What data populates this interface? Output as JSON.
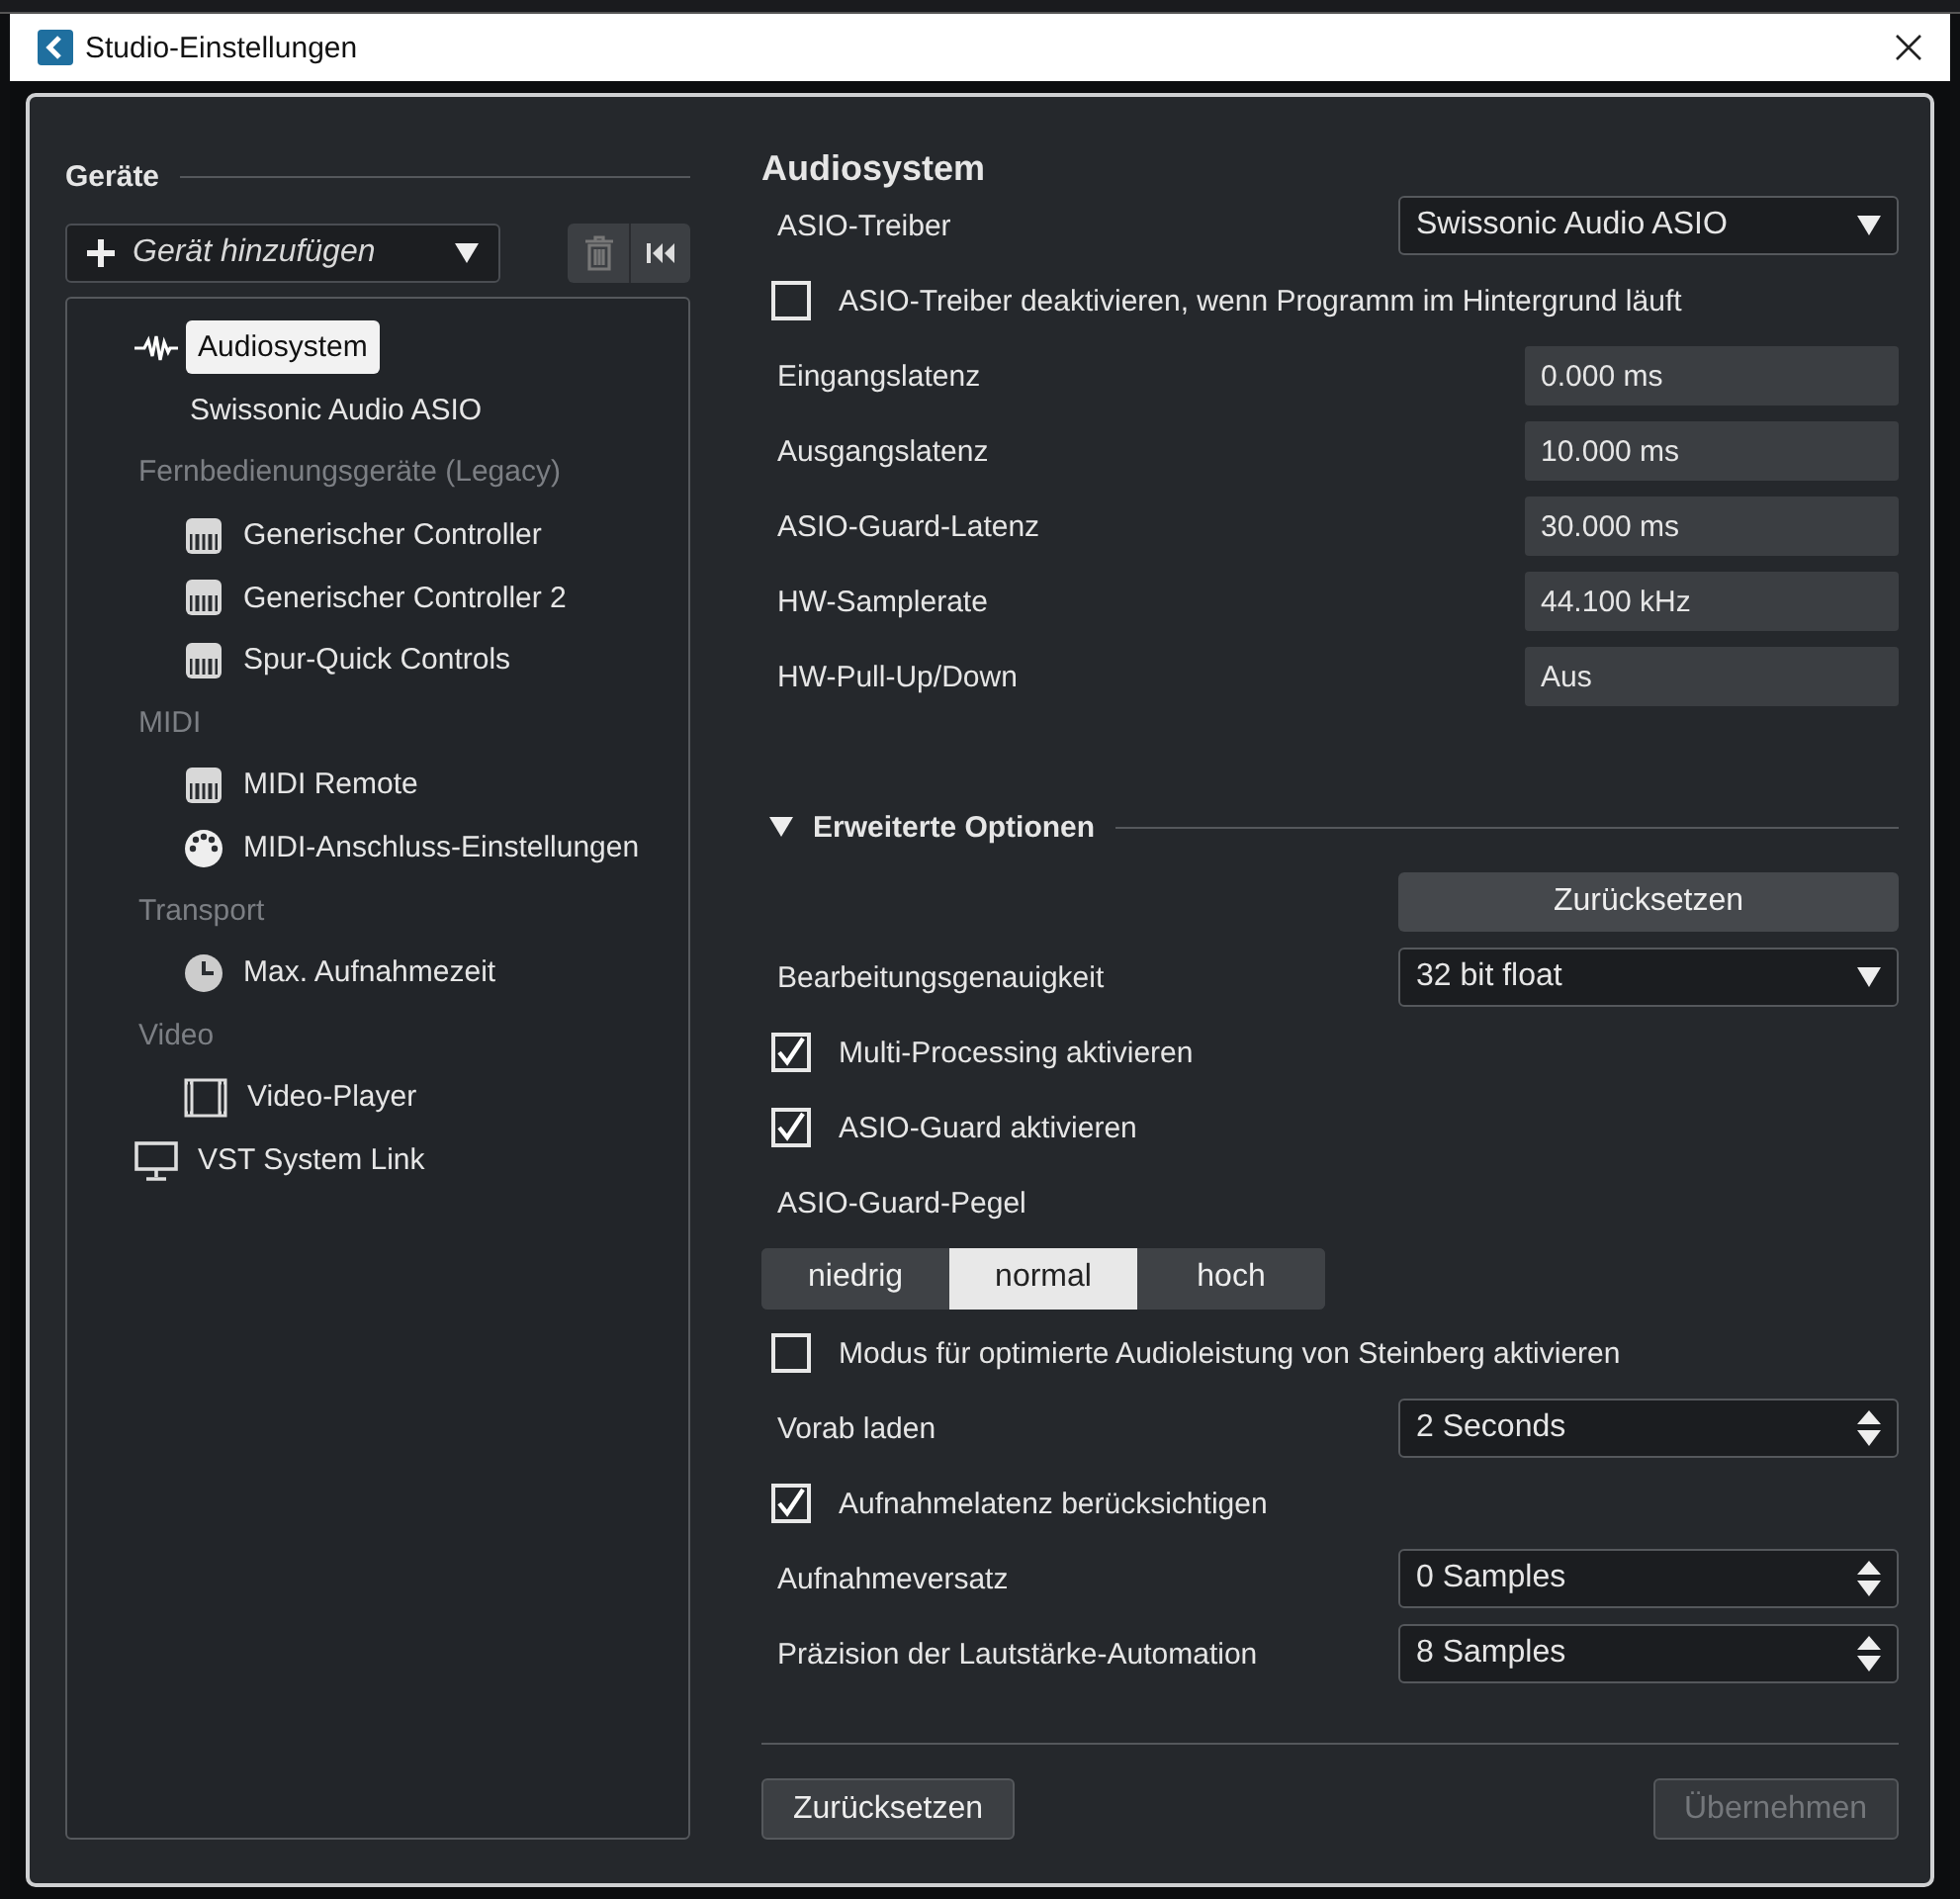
{
  "window": {
    "title": "Studio-Einstellungen"
  },
  "devices": {
    "header": "Geräte",
    "add_device": "Gerät hinzufügen",
    "tree": [
      {
        "kind": "audio",
        "label": "Audiosystem",
        "selected": true,
        "children": [
          {
            "kind": "port",
            "label": "Swissonic Audio ASIO",
            "selected": false
          }
        ]
      },
      {
        "kind": "category",
        "label": "Fernbedienungsgeräte (Legacy)",
        "children": [
          {
            "kind": "controller",
            "label": "Generischer Controller",
            "selected": false
          },
          {
            "kind": "controller",
            "label": "Generischer Controller 2",
            "selected": false
          },
          {
            "kind": "controller",
            "label": "Spur-Quick Controls",
            "selected": false
          }
        ]
      },
      {
        "kind": "category",
        "label": "MIDI",
        "children": [
          {
            "kind": "controller",
            "label": "MIDI Remote",
            "selected": false
          },
          {
            "kind": "midi-port",
            "label": "MIDI-Anschluss-Einstellungen",
            "selected": false
          }
        ]
      },
      {
        "kind": "category",
        "label": "Transport",
        "children": [
          {
            "kind": "timer",
            "label": "Max. Aufnahmezeit",
            "selected": false
          }
        ]
      },
      {
        "kind": "category",
        "label": "Video",
        "children": [
          {
            "kind": "video",
            "label": "Video-Player",
            "selected": false
          }
        ]
      },
      {
        "kind": "network",
        "label": "VST System Link",
        "selected": false
      }
    ]
  },
  "settings": {
    "title": "Audiosystem",
    "rows": [
      {
        "kind": "dropdown",
        "label": "ASIO-Treiber",
        "value": "Swissonic Audio ASIO"
      },
      {
        "kind": "checkbox",
        "label": "ASIO-Treiber deaktivieren, wenn Programm im Hintergrund läuft",
        "checked": false
      },
      {
        "kind": "readout",
        "label": "Eingangslatenz",
        "value": "0.000 ms"
      },
      {
        "kind": "readout",
        "label": "Ausgangslatenz",
        "value": "10.000 ms"
      },
      {
        "kind": "readout",
        "label": "ASIO-Guard-Latenz",
        "value": "30.000 ms"
      },
      {
        "kind": "readout",
        "label": "HW-Samplerate",
        "value": "44.100 kHz"
      },
      {
        "kind": "readout",
        "label": "HW-Pull-Up/Down",
        "value": "Aus"
      }
    ],
    "advanced": {
      "title": "Erweiterte Optionen",
      "expanded": true,
      "reset_button": "Zurücksetzen",
      "rows": [
        {
          "kind": "dropdown",
          "label": "Bearbeitungsgenauigkeit",
          "value": "32 bit float"
        },
        {
          "kind": "checkbox",
          "label": "Multi-Processing aktivieren",
          "checked": true
        },
        {
          "kind": "checkbox",
          "label": "ASIO-Guard aktivieren",
          "checked": true
        },
        {
          "kind": "heading",
          "label": "ASIO-Guard-Pegel"
        },
        {
          "kind": "segmented",
          "options": [
            {
              "label": "niedrig",
              "selected": false
            },
            {
              "label": "normal",
              "selected": true
            },
            {
              "label": "hoch",
              "selected": false
            }
          ]
        },
        {
          "kind": "checkbox",
          "label": "Modus für optimierte Audioleistung von Steinberg aktivieren",
          "checked": false
        },
        {
          "kind": "spinner",
          "label": "Vorab laden",
          "value": "2 Seconds"
        },
        {
          "kind": "checkbox",
          "label": "Aufnahmelatenz berücksichtigen",
          "checked": true
        },
        {
          "kind": "spinner",
          "label": "Aufnahmeversatz",
          "value": "0 Samples"
        },
        {
          "kind": "spinner",
          "label": "Präzision der Lautstärke-Automation",
          "value": "8 Samples"
        }
      ]
    }
  },
  "footer": {
    "buttons": [
      {
        "label": "Zurücksetzen",
        "disabled": false
      },
      {
        "label": "Übernehmen",
        "disabled": true
      }
    ]
  }
}
